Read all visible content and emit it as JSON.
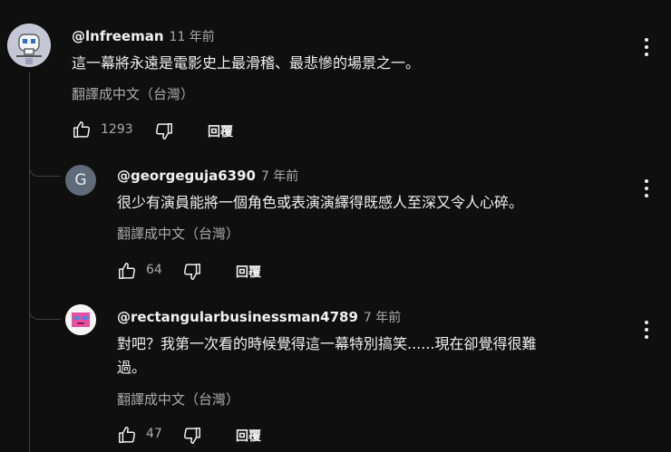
{
  "comments": [
    {
      "handle": "@lnfreeman",
      "time": "11 年前",
      "text": "這一幕將永遠是電影史上最滑稽、最悲慘的場景之一。",
      "translate": "翻譯成中文（台灣）",
      "likes": "1293",
      "reply": "回覆"
    },
    {
      "handle": "@georgeguja6390",
      "time": "7 年前",
      "avatar_letter": "G",
      "text": "很少有演員能將一個角色或表演演繹得既感人至深又令人心碎。",
      "translate": "翻譯成中文（台灣）",
      "likes": "64",
      "reply": "回覆"
    },
    {
      "handle": "@rectangularbusinessman4789",
      "time": "7 年前",
      "text_line1": "對吧？我第一次看的時候覺得這一幕特別搞笑......現在卻覺得很難",
      "text_line2": "過。",
      "translate": "翻譯成中文（台灣）",
      "likes": "47",
      "reply": "回覆"
    }
  ],
  "colors": {
    "background": "#0f0f0f",
    "avatar_g": "#5f6b78",
    "avatar_pink": "#e94fa0"
  }
}
